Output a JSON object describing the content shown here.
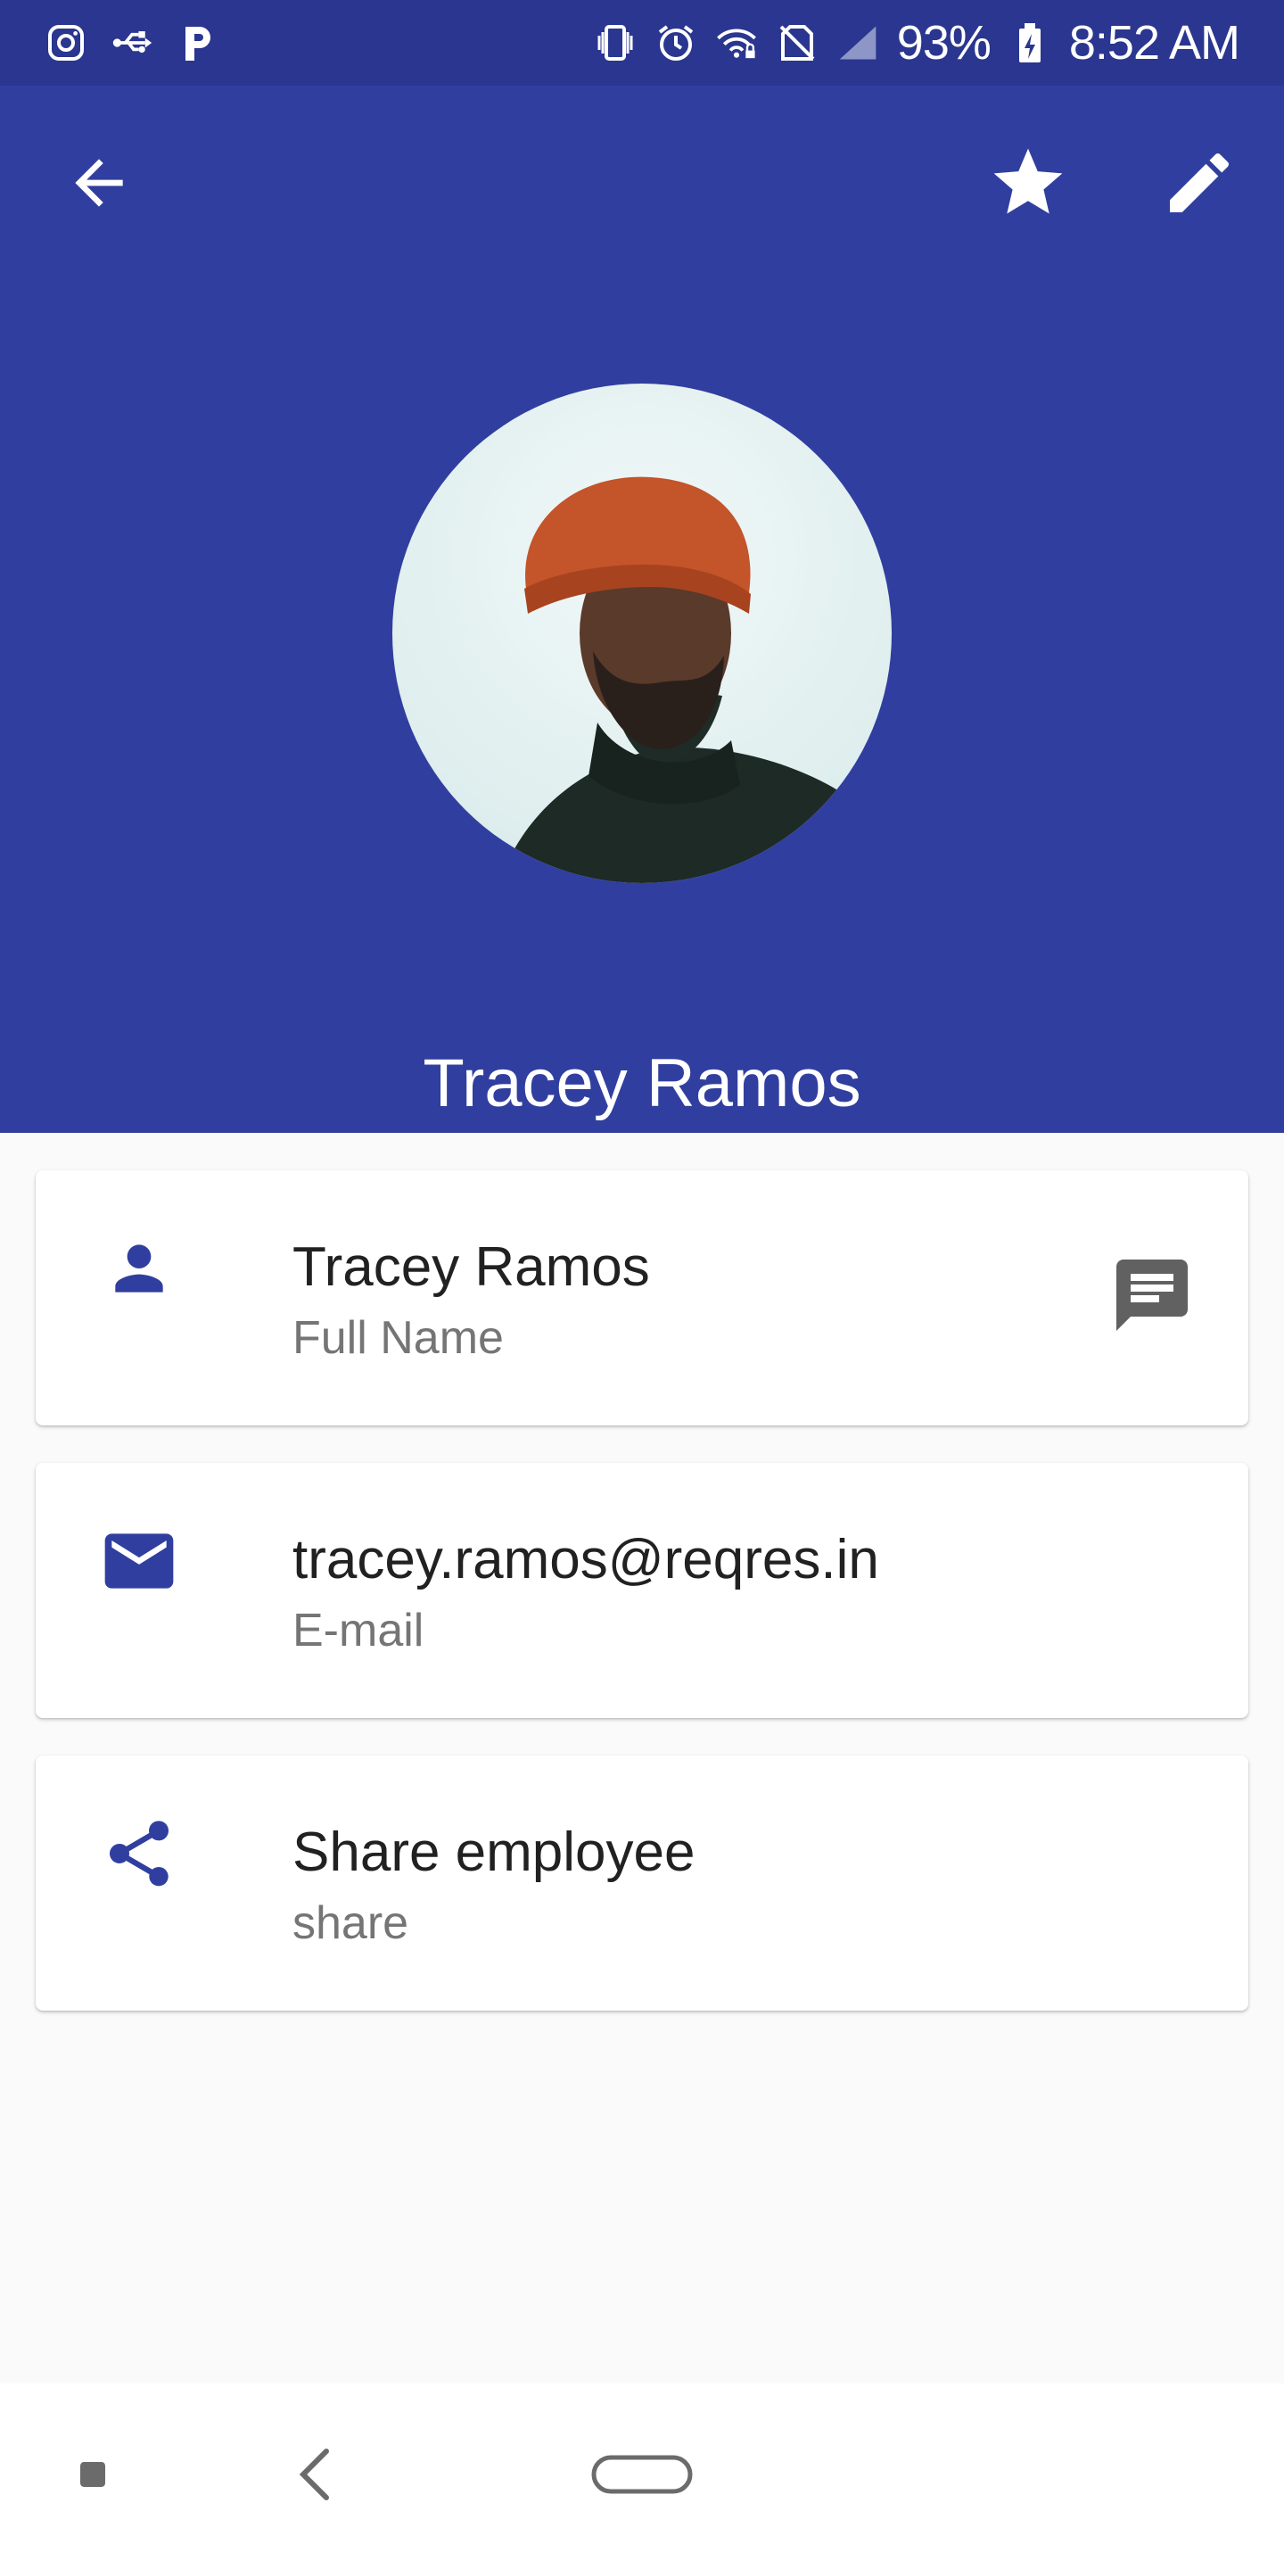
{
  "status_bar": {
    "battery": "93%",
    "time": "8:52 AM",
    "left_icons": [
      "instagram-icon",
      "usb-icon",
      "pandora-icon"
    ],
    "right_icons": [
      "vibrate-icon",
      "alarm-icon",
      "wifi-icon",
      "no-sim-icon",
      "signal-icon",
      "battery-charging-icon"
    ]
  },
  "header": {
    "background": "#303f9f",
    "back_icon": "arrow-back-icon",
    "favorite_icon": "star-icon",
    "edit_icon": "pencil-icon",
    "name": "Tracey Ramos"
  },
  "cards": [
    {
      "icon": "person-icon",
      "title": "Tracey Ramos",
      "subtitle": "Full Name",
      "action_icon": "message-icon"
    },
    {
      "icon": "email-icon",
      "title": "tracey.ramos@reqres.in",
      "subtitle": "E-mail"
    },
    {
      "icon": "share-icon",
      "title": "Share employee",
      "subtitle": "share"
    }
  ],
  "colors": {
    "status_bar": "#2a368f",
    "primary": "#303f9f",
    "icon_accent": "#303f9f",
    "text_primary": "#212121",
    "text_secondary": "#757575"
  }
}
